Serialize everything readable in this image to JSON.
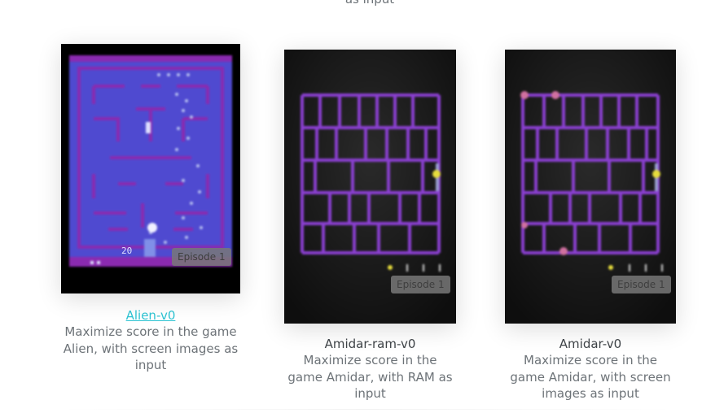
{
  "top_cutoff_text": "as input",
  "cards": [
    {
      "title": "Alien-v0",
      "description": "Maximize score in the game Alien, with screen images as input",
      "episode_label": "Episode 1",
      "score": "20"
    },
    {
      "title": "Amidar-ram-v0",
      "description": "Maximize score in the game Amidar, with RAM as input",
      "episode_label": "Episode 1"
    },
    {
      "title": "Amidar-v0",
      "description": "Maximize score in the game Amidar, with screen images as input",
      "episode_label": "Episode 1"
    }
  ],
  "colors": {
    "link": "#2ec4d3",
    "alien_bg": "#4a46c8",
    "alien_wall": "#8a2ab0",
    "amidar_grid": "#8a3fd0",
    "amidar_bg": "#141414"
  }
}
